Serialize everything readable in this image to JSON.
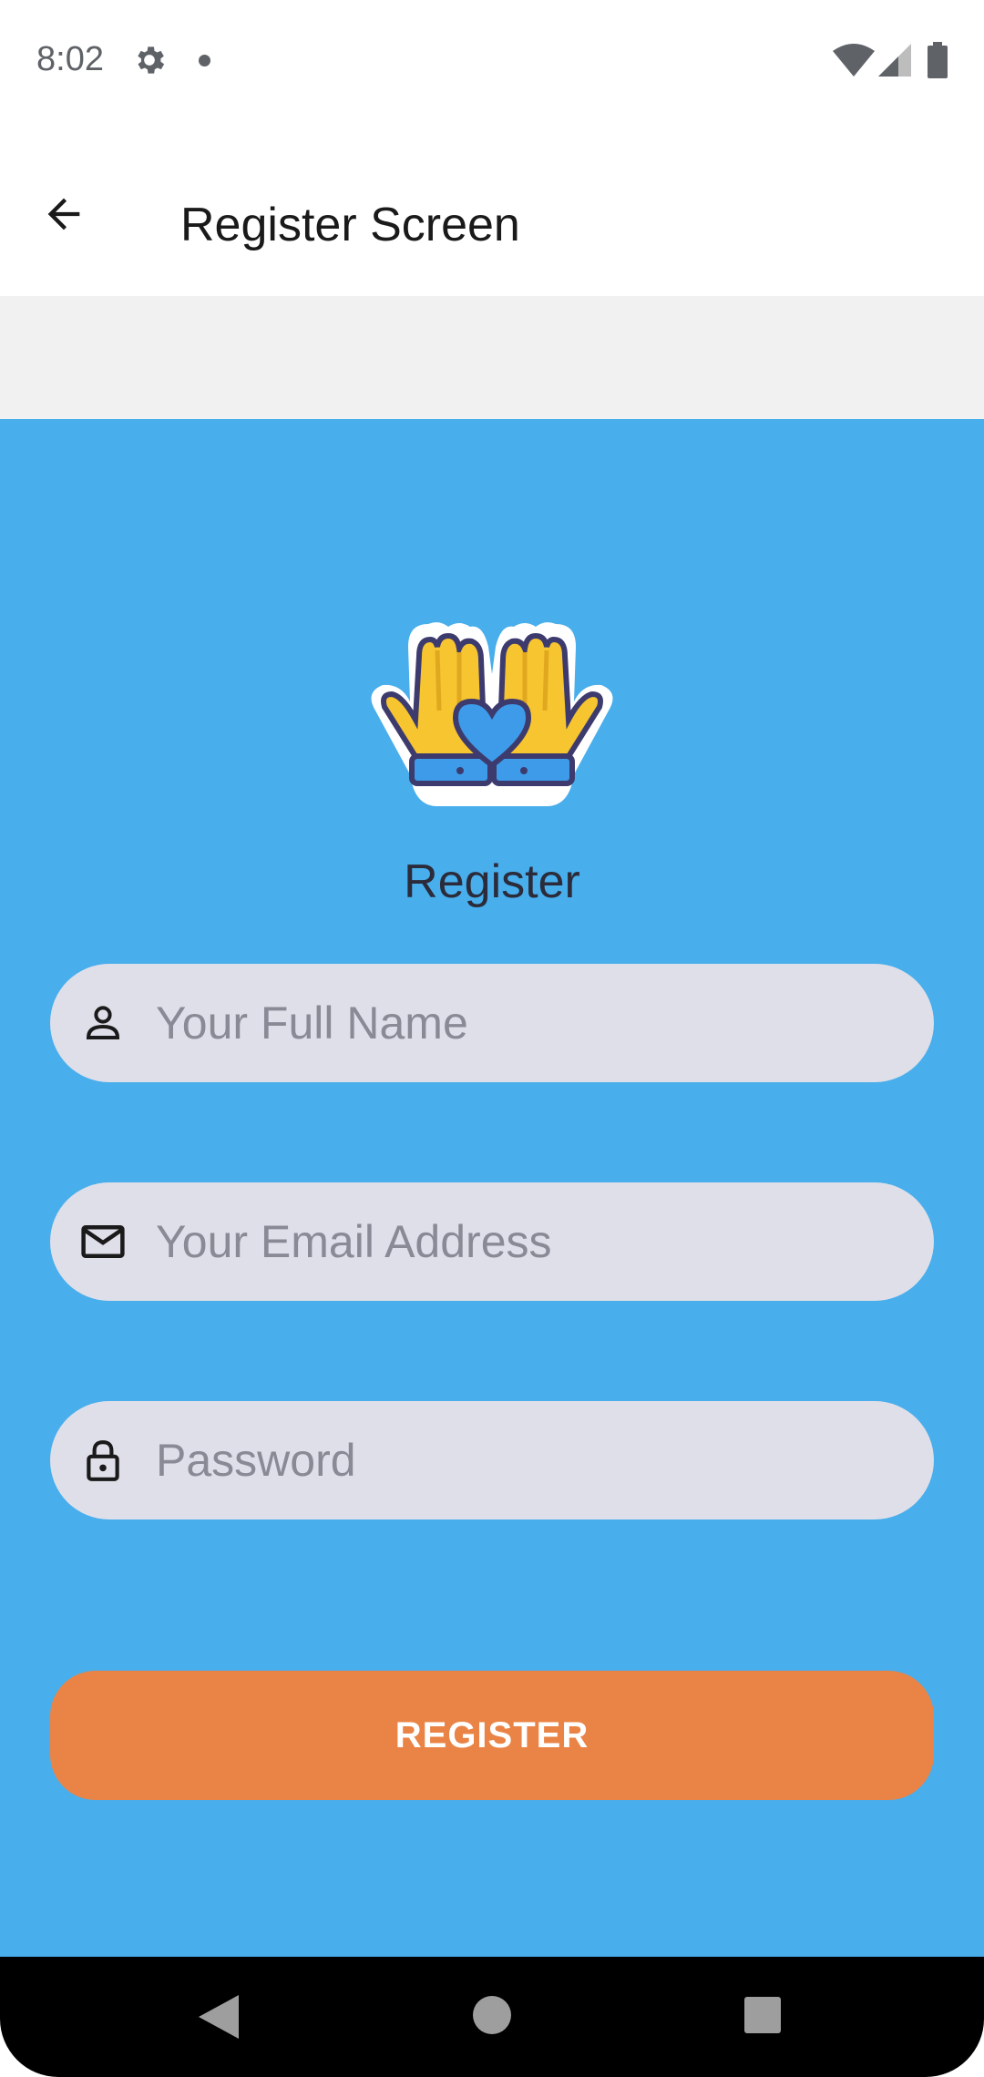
{
  "status_bar": {
    "time": "8:02",
    "icons": [
      "gear-icon",
      "notification-dot-icon",
      "wifi-icon",
      "signal-icon",
      "battery-icon"
    ]
  },
  "app_bar": {
    "title": "Register Screen",
    "back_icon": "arrow-left-icon"
  },
  "main": {
    "background_color": "#48aeec",
    "logo_icon": "hands-heart-logo",
    "heading": "Register",
    "fields": {
      "name": {
        "placeholder": "Your Full Name",
        "value": "",
        "icon": "person-icon"
      },
      "email": {
        "placeholder": "Your Email Address",
        "value": "",
        "icon": "mail-icon"
      },
      "password": {
        "placeholder": "Password",
        "value": "",
        "icon": "lock-icon"
      }
    },
    "register_button": {
      "label": "REGISTER",
      "color": "#ea8446"
    }
  },
  "nav_bar": {
    "icons": [
      "nav-back-icon",
      "nav-home-icon",
      "nav-recents-icon"
    ]
  }
}
